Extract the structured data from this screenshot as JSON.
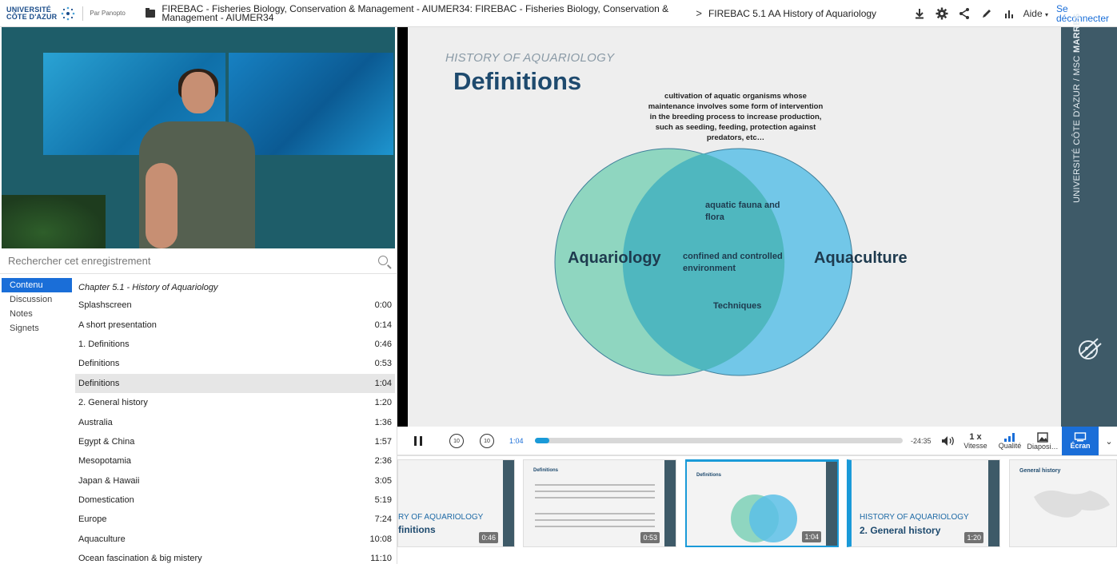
{
  "header": {
    "logo_text_line1": "UNIVERSITÉ",
    "logo_text_line2": "CÔTE D'AZUR",
    "by": "Par Panopto",
    "folder": "FIREBAC - Fisheries Biology, Conservation & Management - AIUMER34: FIREBAC - Fisheries Biology, Conservation & Management - AIUMER34",
    "arrow": ">",
    "session": "FIREBAC 5.1 AA History of Aquariology",
    "help": "Aide",
    "logout": "Se déconnecter"
  },
  "search": {
    "placeholder": "Rechercher cet enregistrement"
  },
  "tabs": [
    "Contenu",
    "Discussion",
    "Notes",
    "Signets"
  ],
  "toc": {
    "chapter": "Chapter 5.1 - History of Aquariology",
    "items": [
      {
        "label": "Splashscreen",
        "time": "0:00"
      },
      {
        "label": "A short presentation",
        "time": "0:14"
      },
      {
        "label": "1. Definitions",
        "time": "0:46"
      },
      {
        "label": "Definitions",
        "time": "0:53"
      },
      {
        "label": "Definitions",
        "time": "1:04"
      },
      {
        "label": "2. General history",
        "time": "1:20"
      },
      {
        "label": "Australia",
        "time": "1:36"
      },
      {
        "label": "Egypt & China",
        "time": "1:57"
      },
      {
        "label": "Mesopotamia",
        "time": "2:36"
      },
      {
        "label": "Japan & Hawaii",
        "time": "3:05"
      },
      {
        "label": "Domestication",
        "time": "5:19"
      },
      {
        "label": "Europe",
        "time": "7:24"
      },
      {
        "label": "Aquaculture",
        "time": "10:08"
      },
      {
        "label": "Ocean fascination & big mistery",
        "time": "11:10"
      }
    ]
  },
  "slide": {
    "kicker": "History of Aquariology",
    "title": "Definitions",
    "definition": "cultivation of aquatic organisms whose maintenance involves some form of intervention in the breeding process to increase production, such as seeding, feeding, protection against predators, etc…",
    "left_circle": "Aquariology",
    "right_circle": "Aquaculture",
    "overlap_1": "aquatic fauna and flora",
    "overlap_2": "confined and controlled environment",
    "overlap_3": "Techniques",
    "band_text_regular": "UNIVERSITÉ CÔTE D'AZUR / MSC ",
    "band_text_bold": "MARRES",
    "colors": {
      "left": "#8fd6c0",
      "right": "#5cc0e6",
      "title": "#1e4a6e",
      "band": "#3e5a68"
    }
  },
  "player": {
    "current_time": "1:04",
    "remaining_time": "-24:35",
    "progress_fraction": 0.04,
    "speed_value": "1 x",
    "speed_label": "Vitesse",
    "quality_label": "Qualité",
    "slides_label": "Diaposi…",
    "screen_label": "Écran"
  },
  "thumbnails": [
    {
      "kicker": "ry of Aquariology",
      "title": "finitions",
      "time": "0:46"
    },
    {
      "title": "Definitions",
      "time": "0:53"
    },
    {
      "title": "Definitions",
      "time": "1:04"
    },
    {
      "kicker": "History of Aquariology",
      "title": "2. General history",
      "time": "1:20"
    },
    {
      "title": "General history",
      "time": ""
    }
  ]
}
